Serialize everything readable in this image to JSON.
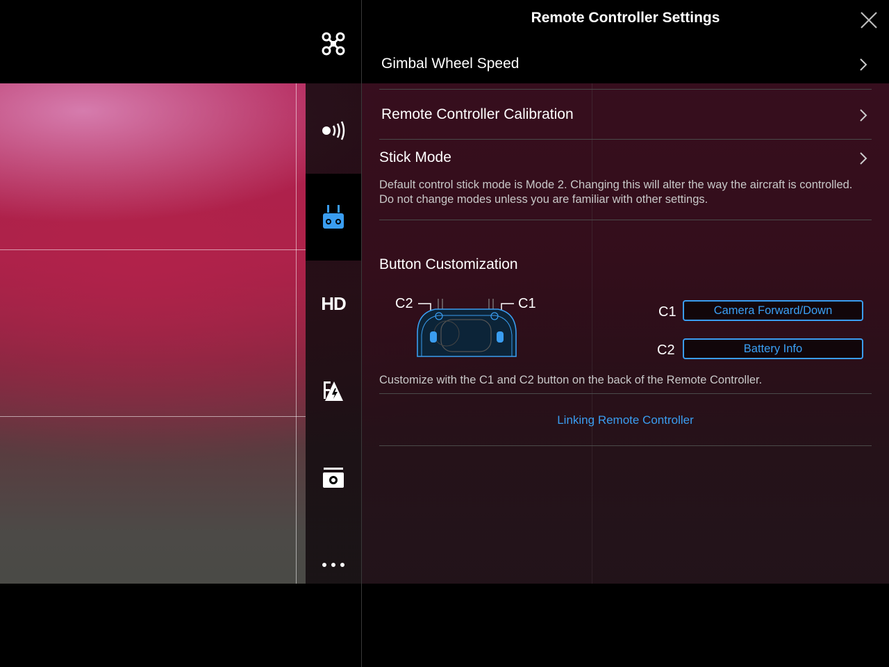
{
  "panel": {
    "title": "Remote Controller Settings"
  },
  "rows": {
    "gimbal_wheel_speed": "Gimbal Wheel Speed",
    "calibration": "Remote Controller Calibration",
    "stick_mode": "Stick Mode",
    "stick_mode_desc": "Default control stick mode is Mode 2. Changing this will alter the way the aircraft is controlled. Do not change modes unless you are familiar with other settings."
  },
  "buttons": {
    "section_title": "Button Customization",
    "diagram_c2": "C2",
    "diagram_c1": "C1",
    "c1_label": "C1",
    "c1_value": "Camera Forward/Down",
    "c2_label": "C2",
    "c2_value": "Battery Info",
    "description": "Customize with the C1 and C2 button on the back of the Remote Controller."
  },
  "link": {
    "label": "Linking Remote Controller"
  },
  "sidebar": {
    "items": [
      {
        "icon": "aircraft-icon"
      },
      {
        "icon": "signal-icon"
      },
      {
        "icon": "remote-controller-icon",
        "active": true
      },
      {
        "icon": "hd-icon",
        "label": "HD"
      },
      {
        "icon": "battery-icon"
      },
      {
        "icon": "camera-icon"
      },
      {
        "icon": "more-icon"
      }
    ]
  },
  "colors": {
    "accent": "#3a9df0",
    "active_icon": "#3a9df0"
  }
}
